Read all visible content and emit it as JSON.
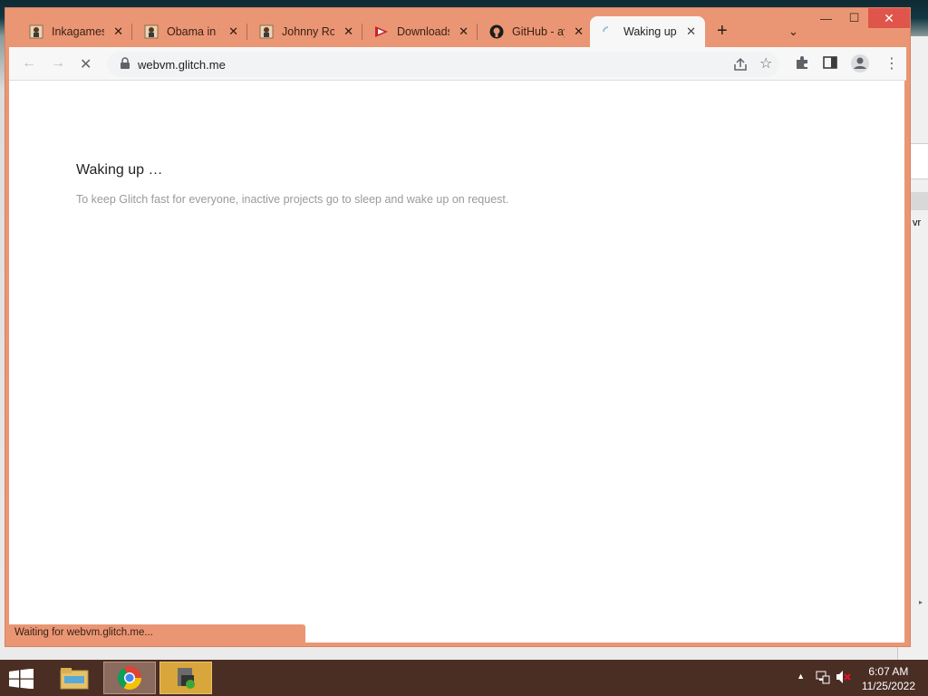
{
  "tabs": [
    {
      "title": "Inkagames",
      "favicon": "avatar-icon"
    },
    {
      "title": "Obama in the",
      "favicon": "avatar-icon"
    },
    {
      "title": "Johnny Roc",
      "favicon": "avatar-icon"
    },
    {
      "title": "Downloads",
      "favicon": "download-icon"
    },
    {
      "title": "GitHub - ay",
      "favicon": "github-icon"
    },
    {
      "title": "Waking up",
      "favicon": "loading-icon",
      "active": true
    }
  ],
  "address": {
    "url": "webvm.glitch.me"
  },
  "page": {
    "heading": "Waking up …",
    "description": "To keep Glitch fast for everyone, inactive projects go to sleep and wake up on request."
  },
  "status": {
    "text": "Waiting for webvm.glitch.me..."
  },
  "clock": {
    "time": "6:07 AM",
    "date": "11/25/2022"
  },
  "background_window": {
    "fragment": "vr"
  },
  "colors": {
    "frame": "#ea9674",
    "taskbar": "#4a2e24",
    "close": "#e0554b"
  }
}
